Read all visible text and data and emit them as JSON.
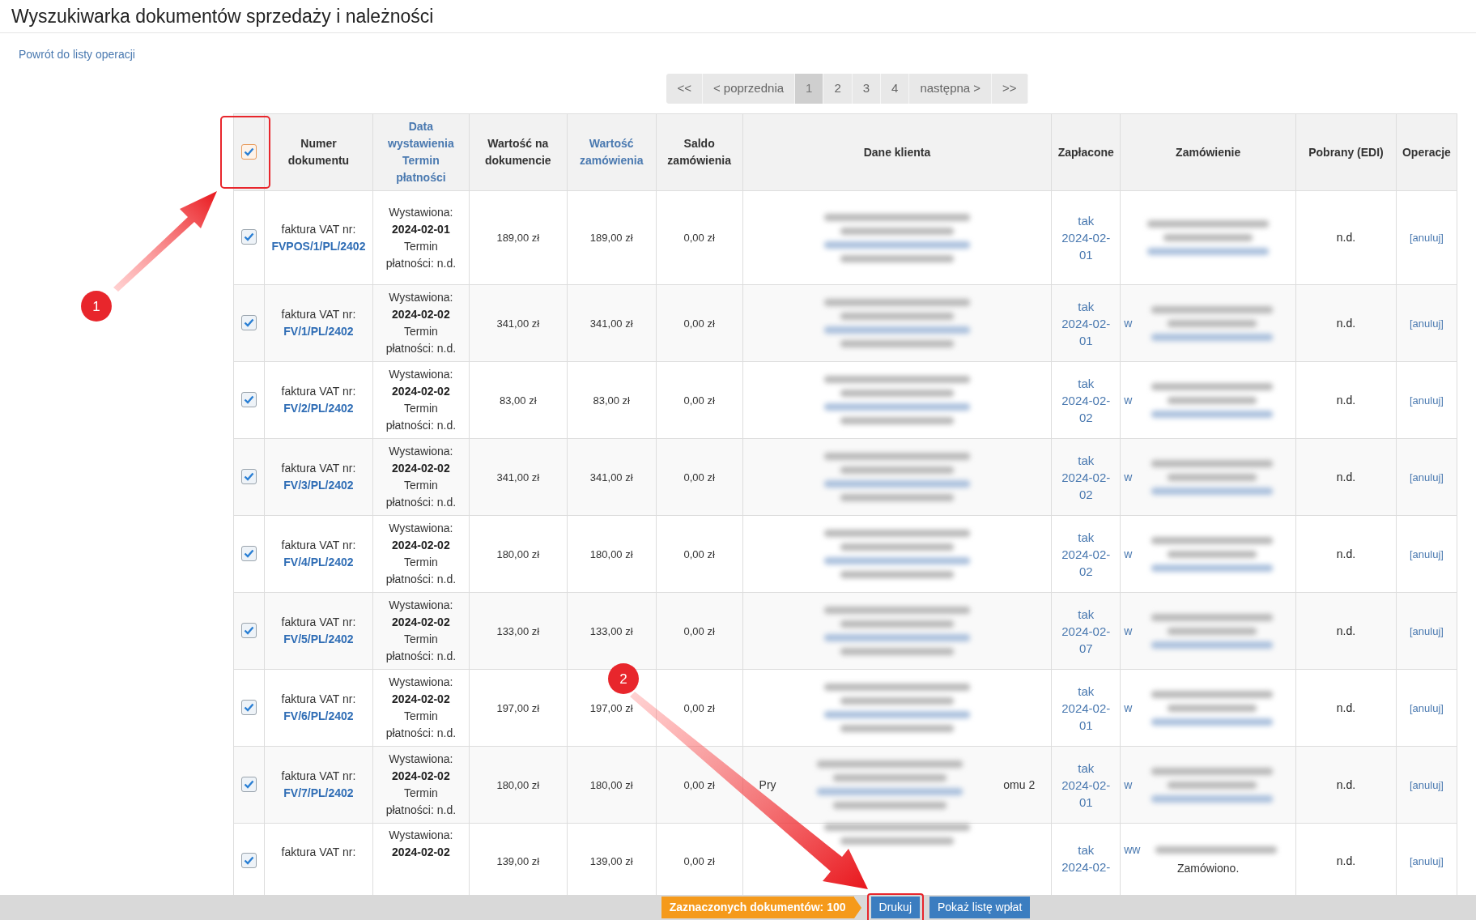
{
  "title": "Wyszukiwarka dokumentów sprzedaży i należności",
  "back_link": "Powrót do listy operacji",
  "pagination": [
    {
      "label": "<<",
      "selected": false
    },
    {
      "label": "< poprzednia",
      "selected": false
    },
    {
      "label": "1",
      "selected": true
    },
    {
      "label": "2",
      "selected": false
    },
    {
      "label": "3",
      "selected": false
    },
    {
      "label": "4",
      "selected": false
    },
    {
      "label": "następna >",
      "selected": false
    },
    {
      "label": ">>",
      "selected": false
    }
  ],
  "select_all": {
    "checked": true
  },
  "columns": [
    {
      "lines": [
        "Numer",
        "dokumentu"
      ],
      "link": false
    },
    {
      "lines": [
        "Data",
        "wystawienia",
        "Termin",
        "płatności"
      ],
      "link": true
    },
    {
      "lines": [
        "Wartość na",
        "dokumencie"
      ],
      "link": false
    },
    {
      "lines": [
        "Wartość",
        "zamówienia"
      ],
      "link": true
    },
    {
      "lines": [
        "Saldo",
        "zamówienia"
      ],
      "link": false
    },
    {
      "lines": [
        "Dane klienta"
      ],
      "link": false
    },
    {
      "lines": [
        "Zapłacone"
      ],
      "link": false
    },
    {
      "lines": [
        "Zamówienie"
      ],
      "link": false
    },
    {
      "lines": [
        "Pobrany (EDI)"
      ],
      "link": false
    },
    {
      "lines": [
        "Operacje"
      ],
      "link": false
    }
  ],
  "rows": [
    {
      "checked": true,
      "doc_label": "faktura VAT nr:",
      "doc_number": "FVPOS/1/PL/2402",
      "issued_label": "Wystawiona:",
      "issued": "2024-02-01",
      "due": [
        "Termin",
        "płatności: n.d."
      ],
      "value": "189,00 zł",
      "order_value": "189,00 zł",
      "balance": "0,00 zł",
      "paid": [
        "tak",
        "2024-02-",
        "01"
      ],
      "edi": "n.d.",
      "action": "[anuluj]"
    },
    {
      "checked": true,
      "doc_label": "faktura VAT nr:",
      "doc_number": "FV/1/PL/2402",
      "issued_label": "Wystawiona:",
      "issued": "2024-02-02",
      "due": [
        "Termin",
        "płatności: n.d."
      ],
      "value": "341,00 zł",
      "order_value": "341,00 zł",
      "balance": "0,00 zł",
      "paid": [
        "tak",
        "2024-02-",
        "01"
      ],
      "order_prefix": "w",
      "edi": "n.d.",
      "action": "[anuluj]"
    },
    {
      "checked": true,
      "doc_label": "faktura VAT nr:",
      "doc_number": "FV/2/PL/2402",
      "issued_label": "Wystawiona:",
      "issued": "2024-02-02",
      "due": [
        "Termin",
        "płatności: n.d."
      ],
      "value": "83,00 zł",
      "order_value": "83,00 zł",
      "balance": "0,00 zł",
      "paid": [
        "tak",
        "2024-02-",
        "02"
      ],
      "order_prefix": "w",
      "edi": "n.d.",
      "action": "[anuluj]"
    },
    {
      "checked": true,
      "doc_label": "faktura VAT nr:",
      "doc_number": "FV/3/PL/2402",
      "issued_label": "Wystawiona:",
      "issued": "2024-02-02",
      "due": [
        "Termin",
        "płatności: n.d."
      ],
      "value": "341,00 zł",
      "order_value": "341,00 zł",
      "balance": "0,00 zł",
      "paid": [
        "tak",
        "2024-02-",
        "02"
      ],
      "order_prefix": "w",
      "edi": "n.d.",
      "action": "[anuluj]"
    },
    {
      "checked": true,
      "doc_label": "faktura VAT nr:",
      "doc_number": "FV/4/PL/2402",
      "issued_label": "Wystawiona:",
      "issued": "2024-02-02",
      "due": [
        "Termin",
        "płatności: n.d."
      ],
      "value": "180,00 zł",
      "order_value": "180,00 zł",
      "balance": "0,00 zł",
      "paid": [
        "tak",
        "2024-02-",
        "02"
      ],
      "order_prefix": "w",
      "edi": "n.d.",
      "action": "[anuluj]"
    },
    {
      "checked": true,
      "doc_label": "faktura VAT nr:",
      "doc_number": "FV/5/PL/2402",
      "issued_label": "Wystawiona:",
      "issued": "2024-02-02",
      "due": [
        "Termin",
        "płatności: n.d."
      ],
      "value": "133,00 zł",
      "order_value": "133,00 zł",
      "balance": "0,00 zł",
      "paid": [
        "tak",
        "2024-02-",
        "07"
      ],
      "order_prefix": "w",
      "edi": "n.d.",
      "action": "[anuluj]"
    },
    {
      "checked": true,
      "doc_label": "faktura VAT nr:",
      "doc_number": "FV/6/PL/2402",
      "issued_label": "Wystawiona:",
      "issued": "2024-02-02",
      "due": [
        "Termin",
        "płatności: n.d."
      ],
      "value": "197,00 zł",
      "order_value": "197,00 zł",
      "balance": "0,00 zł",
      "paid": [
        "tak",
        "2024-02-",
        "01"
      ],
      "order_prefix": "w",
      "edi": "n.d.",
      "action": "[anuluj]"
    },
    {
      "checked": true,
      "doc_label": "faktura VAT nr:",
      "doc_number": "FV/7/PL/2402",
      "issued_label": "Wystawiona:",
      "issued": "2024-02-02",
      "due": [
        "Termin",
        "płatności: n.d."
      ],
      "value": "180,00 zł",
      "order_value": "180,00 zł",
      "balance": "0,00 zł",
      "client_left": "Pry",
      "client_right": "omu 2",
      "paid": [
        "tak",
        "2024-02-",
        "01"
      ],
      "order_prefix": "w",
      "edi": "n.d.",
      "action": "[anuluj]"
    },
    {
      "checked": true,
      "doc_label": "faktura VAT nr:",
      "issued_label": "Wystawiona:",
      "issued": "2024-02-02",
      "value": "139,00 zł",
      "order_value": "139,00 zł",
      "balance": "0,00 zł",
      "paid": [
        "tak",
        "2024-02-"
      ],
      "order_prefix": "ww",
      "order_note": "Zamówiono.",
      "edi": "n.d.",
      "action": "[anuluj]"
    }
  ],
  "footer": {
    "selected_count": "Zaznaczonych dokumentów: 100",
    "buttons": [
      "Drukuj",
      "Pokaż listę wpłat"
    ]
  },
  "annotations": [
    {
      "label": "1"
    },
    {
      "label": "2"
    }
  ]
}
